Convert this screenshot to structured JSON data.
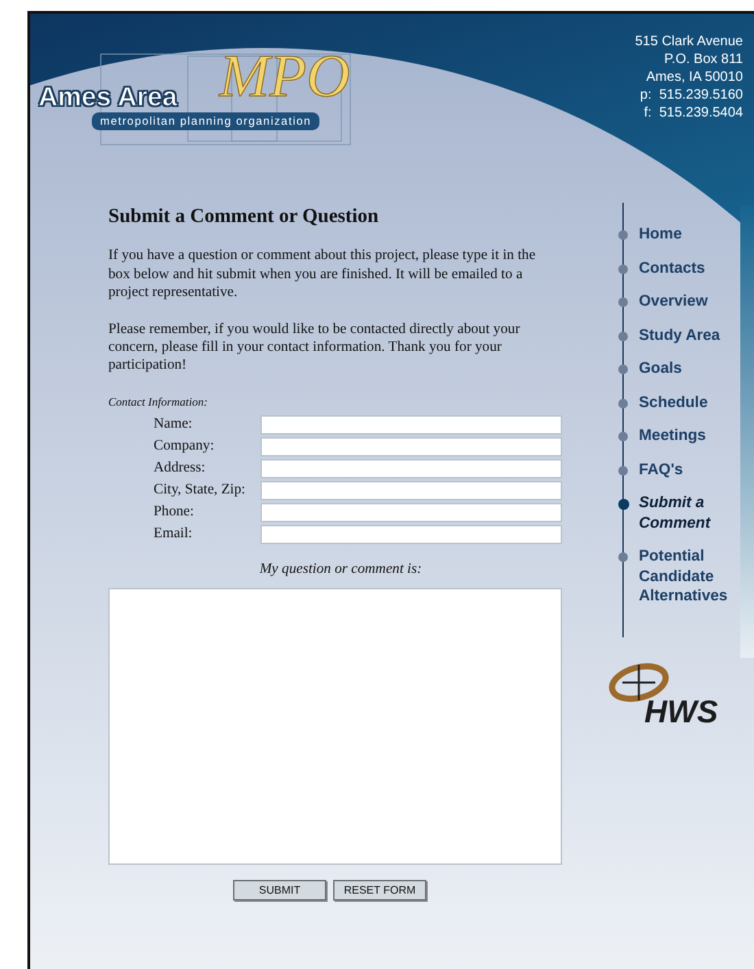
{
  "logo": {
    "title": "Ames Area",
    "mark": "MPO",
    "tagline": "metropolitan planning organization"
  },
  "address": [
    "515 Clark Avenue",
    "P.O. Box 811",
    "Ames, IA 50010",
    "p:  515.239.5160",
    "f:  515.239.5404"
  ],
  "form": {
    "heading": "Submit a Comment or Question",
    "paragraphs": [
      "If you have a question or comment about this project, please type it in the box below and hit submit when you are finished. It will be emailed to a project representative.",
      "Please remember, if you would like to be contacted directly about your concern, please fill in your contact information. Thank you for your participation!"
    ],
    "contact_caption": "Contact Information:",
    "fields": [
      {
        "label": "Name:"
      },
      {
        "label": "Company:"
      },
      {
        "label": "Address:"
      },
      {
        "label": "City, State, Zip:"
      },
      {
        "label": "Phone:"
      },
      {
        "label": "Email:"
      }
    ],
    "comment_label": "My question or comment is:",
    "buttons": [
      "SUBMIT",
      "RESET FORM"
    ]
  },
  "nav": [
    {
      "label": "Home",
      "selected": false
    },
    {
      "label": "Contacts",
      "selected": false
    },
    {
      "label": "Overview",
      "selected": false
    },
    {
      "label": "Study Area",
      "selected": false
    },
    {
      "label": "Goals",
      "selected": false
    },
    {
      "label": "Schedule",
      "selected": false
    },
    {
      "label": "Meetings",
      "selected": false
    },
    {
      "label": "FAQ's",
      "selected": false
    },
    {
      "label": "Submit a Comment",
      "selected": true
    },
    {
      "label": "Potential Candidate Alternatives",
      "selected": false
    }
  ],
  "partner_logo": {
    "name": "HWS"
  }
}
